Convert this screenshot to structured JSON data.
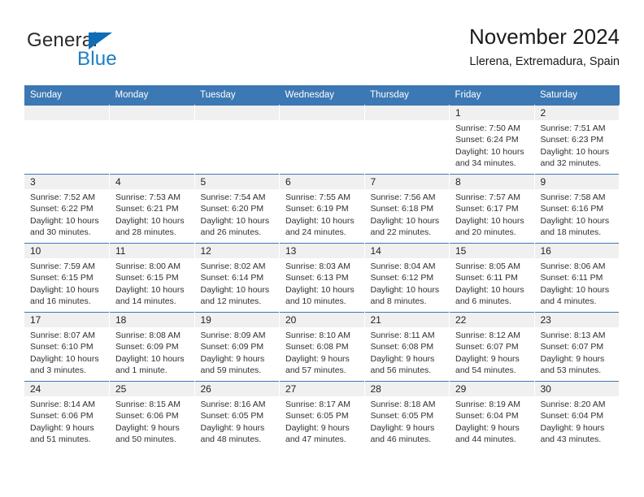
{
  "brand": {
    "name_part1": "General",
    "name_part2": "Blue",
    "logo_icon": "triangle-logo-icon"
  },
  "header": {
    "title": "November 2024",
    "subtitle": "Llerena, Extremadura, Spain"
  },
  "colors": {
    "header_blue": "#3c78b4",
    "brand_blue": "#1b7fc4",
    "daynum_bg": "#f0f0f0",
    "text": "#303030"
  },
  "weekday_headers": [
    "Sunday",
    "Monday",
    "Tuesday",
    "Wednesday",
    "Thursday",
    "Friday",
    "Saturday"
  ],
  "weeks": [
    [
      {
        "day": "",
        "empty": true
      },
      {
        "day": "",
        "empty": true
      },
      {
        "day": "",
        "empty": true
      },
      {
        "day": "",
        "empty": true
      },
      {
        "day": "",
        "empty": true
      },
      {
        "day": "1",
        "sunrise": "Sunrise: 7:50 AM",
        "sunset": "Sunset: 6:24 PM",
        "daylight_line1": "Daylight: 10 hours",
        "daylight_line2": "and 34 minutes."
      },
      {
        "day": "2",
        "sunrise": "Sunrise: 7:51 AM",
        "sunset": "Sunset: 6:23 PM",
        "daylight_line1": "Daylight: 10 hours",
        "daylight_line2": "and 32 minutes."
      }
    ],
    [
      {
        "day": "3",
        "sunrise": "Sunrise: 7:52 AM",
        "sunset": "Sunset: 6:22 PM",
        "daylight_line1": "Daylight: 10 hours",
        "daylight_line2": "and 30 minutes."
      },
      {
        "day": "4",
        "sunrise": "Sunrise: 7:53 AM",
        "sunset": "Sunset: 6:21 PM",
        "daylight_line1": "Daylight: 10 hours",
        "daylight_line2": "and 28 minutes."
      },
      {
        "day": "5",
        "sunrise": "Sunrise: 7:54 AM",
        "sunset": "Sunset: 6:20 PM",
        "daylight_line1": "Daylight: 10 hours",
        "daylight_line2": "and 26 minutes."
      },
      {
        "day": "6",
        "sunrise": "Sunrise: 7:55 AM",
        "sunset": "Sunset: 6:19 PM",
        "daylight_line1": "Daylight: 10 hours",
        "daylight_line2": "and 24 minutes."
      },
      {
        "day": "7",
        "sunrise": "Sunrise: 7:56 AM",
        "sunset": "Sunset: 6:18 PM",
        "daylight_line1": "Daylight: 10 hours",
        "daylight_line2": "and 22 minutes."
      },
      {
        "day": "8",
        "sunrise": "Sunrise: 7:57 AM",
        "sunset": "Sunset: 6:17 PM",
        "daylight_line1": "Daylight: 10 hours",
        "daylight_line2": "and 20 minutes."
      },
      {
        "day": "9",
        "sunrise": "Sunrise: 7:58 AM",
        "sunset": "Sunset: 6:16 PM",
        "daylight_line1": "Daylight: 10 hours",
        "daylight_line2": "and 18 minutes."
      }
    ],
    [
      {
        "day": "10",
        "sunrise": "Sunrise: 7:59 AM",
        "sunset": "Sunset: 6:15 PM",
        "daylight_line1": "Daylight: 10 hours",
        "daylight_line2": "and 16 minutes."
      },
      {
        "day": "11",
        "sunrise": "Sunrise: 8:00 AM",
        "sunset": "Sunset: 6:15 PM",
        "daylight_line1": "Daylight: 10 hours",
        "daylight_line2": "and 14 minutes."
      },
      {
        "day": "12",
        "sunrise": "Sunrise: 8:02 AM",
        "sunset": "Sunset: 6:14 PM",
        "daylight_line1": "Daylight: 10 hours",
        "daylight_line2": "and 12 minutes."
      },
      {
        "day": "13",
        "sunrise": "Sunrise: 8:03 AM",
        "sunset": "Sunset: 6:13 PM",
        "daylight_line1": "Daylight: 10 hours",
        "daylight_line2": "and 10 minutes."
      },
      {
        "day": "14",
        "sunrise": "Sunrise: 8:04 AM",
        "sunset": "Sunset: 6:12 PM",
        "daylight_line1": "Daylight: 10 hours",
        "daylight_line2": "and 8 minutes."
      },
      {
        "day": "15",
        "sunrise": "Sunrise: 8:05 AM",
        "sunset": "Sunset: 6:11 PM",
        "daylight_line1": "Daylight: 10 hours",
        "daylight_line2": "and 6 minutes."
      },
      {
        "day": "16",
        "sunrise": "Sunrise: 8:06 AM",
        "sunset": "Sunset: 6:11 PM",
        "daylight_line1": "Daylight: 10 hours",
        "daylight_line2": "and 4 minutes."
      }
    ],
    [
      {
        "day": "17",
        "sunrise": "Sunrise: 8:07 AM",
        "sunset": "Sunset: 6:10 PM",
        "daylight_line1": "Daylight: 10 hours",
        "daylight_line2": "and 3 minutes."
      },
      {
        "day": "18",
        "sunrise": "Sunrise: 8:08 AM",
        "sunset": "Sunset: 6:09 PM",
        "daylight_line1": "Daylight: 10 hours",
        "daylight_line2": "and 1 minute."
      },
      {
        "day": "19",
        "sunrise": "Sunrise: 8:09 AM",
        "sunset": "Sunset: 6:09 PM",
        "daylight_line1": "Daylight: 9 hours",
        "daylight_line2": "and 59 minutes."
      },
      {
        "day": "20",
        "sunrise": "Sunrise: 8:10 AM",
        "sunset": "Sunset: 6:08 PM",
        "daylight_line1": "Daylight: 9 hours",
        "daylight_line2": "and 57 minutes."
      },
      {
        "day": "21",
        "sunrise": "Sunrise: 8:11 AM",
        "sunset": "Sunset: 6:08 PM",
        "daylight_line1": "Daylight: 9 hours",
        "daylight_line2": "and 56 minutes."
      },
      {
        "day": "22",
        "sunrise": "Sunrise: 8:12 AM",
        "sunset": "Sunset: 6:07 PM",
        "daylight_line1": "Daylight: 9 hours",
        "daylight_line2": "and 54 minutes."
      },
      {
        "day": "23",
        "sunrise": "Sunrise: 8:13 AM",
        "sunset": "Sunset: 6:07 PM",
        "daylight_line1": "Daylight: 9 hours",
        "daylight_line2": "and 53 minutes."
      }
    ],
    [
      {
        "day": "24",
        "sunrise": "Sunrise: 8:14 AM",
        "sunset": "Sunset: 6:06 PM",
        "daylight_line1": "Daylight: 9 hours",
        "daylight_line2": "and 51 minutes."
      },
      {
        "day": "25",
        "sunrise": "Sunrise: 8:15 AM",
        "sunset": "Sunset: 6:06 PM",
        "daylight_line1": "Daylight: 9 hours",
        "daylight_line2": "and 50 minutes."
      },
      {
        "day": "26",
        "sunrise": "Sunrise: 8:16 AM",
        "sunset": "Sunset: 6:05 PM",
        "daylight_line1": "Daylight: 9 hours",
        "daylight_line2": "and 48 minutes."
      },
      {
        "day": "27",
        "sunrise": "Sunrise: 8:17 AM",
        "sunset": "Sunset: 6:05 PM",
        "daylight_line1": "Daylight: 9 hours",
        "daylight_line2": "and 47 minutes."
      },
      {
        "day": "28",
        "sunrise": "Sunrise: 8:18 AM",
        "sunset": "Sunset: 6:05 PM",
        "daylight_line1": "Daylight: 9 hours",
        "daylight_line2": "and 46 minutes."
      },
      {
        "day": "29",
        "sunrise": "Sunrise: 8:19 AM",
        "sunset": "Sunset: 6:04 PM",
        "daylight_line1": "Daylight: 9 hours",
        "daylight_line2": "and 44 minutes."
      },
      {
        "day": "30",
        "sunrise": "Sunrise: 8:20 AM",
        "sunset": "Sunset: 6:04 PM",
        "daylight_line1": "Daylight: 9 hours",
        "daylight_line2": "and 43 minutes."
      }
    ]
  ]
}
